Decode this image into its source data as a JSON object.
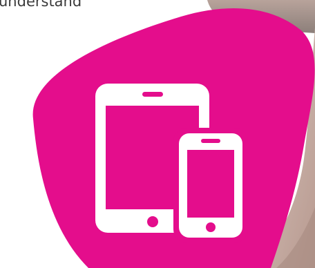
{
  "header": {
    "partial_text": "understand"
  },
  "graphic": {
    "blob_color": "#e40d8c",
    "device_color": "#ffffff",
    "icons": [
      "tablet-icon",
      "smartphone-icon"
    ]
  }
}
